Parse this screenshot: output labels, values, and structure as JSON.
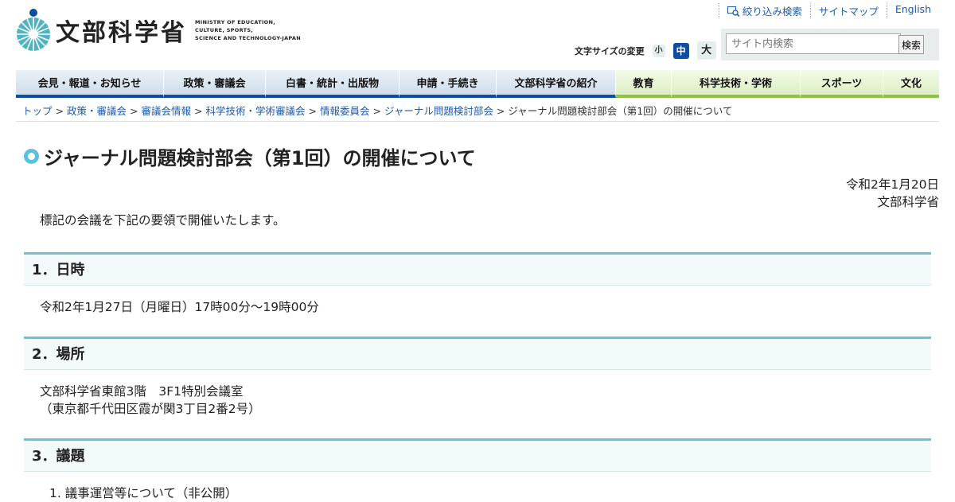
{
  "header": {
    "logo_name": "文部科学省",
    "logo_en": [
      "MINISTRY OF EDUCATION,",
      "CULTURE, SPORTS,",
      "SCIENCE AND TECHNOLOGY-JAPAN"
    ],
    "util_links": [
      "絞り込み検索",
      "サイトマップ",
      "English"
    ],
    "font_size_label": "文字サイズの変更",
    "font_sizes": [
      "小",
      "中",
      "大"
    ],
    "search_placeholder": "サイト内検索",
    "search_button": "検索"
  },
  "nav": [
    {
      "label": "会見・報道・お知らせ"
    },
    {
      "label": "政策・審議会"
    },
    {
      "label": "白書・統計・出版物"
    },
    {
      "label": "申請・手続き"
    },
    {
      "label": "文部科学省の紹介"
    },
    {
      "label": "教育"
    },
    {
      "label": "科学技術・学術"
    },
    {
      "label": "スポーツ"
    },
    {
      "label": "文化"
    }
  ],
  "breadcrumb": [
    "トップ",
    "政策・審議会",
    "審議会情報",
    "科学技術・学術審議会",
    "情報委員会",
    "ジャーナル問題検討部会",
    "ジャーナル問題検討部会（第1回）の開催について"
  ],
  "page": {
    "title": "ジャーナル問題検討部会（第1回）の開催について",
    "date": "令和2年1月20日",
    "org": "文部科学省",
    "intro": "標記の会議を下記の要領で開催いたします。"
  },
  "sections": [
    {
      "heading": "1．日時",
      "lines": [
        "令和2年1月27日（月曜日）17時00分～19時00分"
      ]
    },
    {
      "heading": "2．場所",
      "lines": [
        "文部科学省東館3階　3F1特別会議室",
        "（東京都千代田区霞が関3丁目2番2号）"
      ]
    },
    {
      "heading": "3．議題",
      "lines": [
        "1. 議事運営等について（非公開）"
      ]
    }
  ],
  "colors": {
    "nav_blue": "#0b4ea2",
    "nav_green": "#8cc63f",
    "section_rule": "#6cc2d4",
    "link": "#1e5aa8"
  }
}
